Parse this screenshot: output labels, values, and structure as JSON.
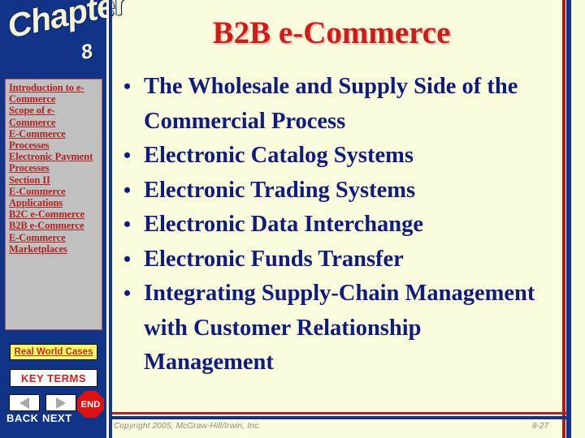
{
  "colors": {
    "sidebar_navy": "#113388",
    "content_cream": "#fbfbdd",
    "title_red": "#cc1d1d",
    "body_navy": "#101c7a",
    "link_red": "#b22222",
    "panel_gray": "#c0c0c0",
    "highlight_yellow": "#ffff66",
    "stop_red": "#dd1111",
    "stripe_red": "#aa1a1a"
  },
  "sidebar": {
    "logo": {
      "word": "Chapter",
      "number": "8"
    },
    "nav_links": [
      {
        "label": "Introduction to e-Commerce"
      },
      {
        "label": "Scope of e-Commerce"
      },
      {
        "label": "E-Commerce Processes"
      },
      {
        "label": "Electronic Payment Processes"
      },
      {
        "label": "Section II"
      },
      {
        "label": "E-Commerce Applications"
      },
      {
        "label": "B2C e-Commerce"
      },
      {
        "label": "B2B e-Commerce"
      },
      {
        "label": "E-Commerce Marketplaces"
      }
    ],
    "real_world_cases_label": "Real World Cases",
    "key_terms_label": "KEY TERMS",
    "back_label": "BACK",
    "next_label": "NEXT",
    "end_label": "END",
    "back_icon": "triangle-left-icon",
    "next_icon": "triangle-right-icon",
    "end_icon": "stop-sign-icon"
  },
  "main": {
    "title": "B2B e-Commerce",
    "bullet_marker": "•",
    "bullets": [
      {
        "text": "The Wholesale and Supply Side of the Commercial Process"
      },
      {
        "text": "Electronic Catalog Systems"
      },
      {
        "text": "Electronic Trading Systems"
      },
      {
        "text": "Electronic Data Interchange"
      },
      {
        "text": "Electronic Funds Transfer"
      },
      {
        "text": "Integrating Supply-Chain Management with Customer Relationship Management"
      }
    ]
  },
  "footer": {
    "copyright": "Copyright 2005, McGraw-Hill/Irwin, Inc.",
    "page_number": "8-27"
  }
}
